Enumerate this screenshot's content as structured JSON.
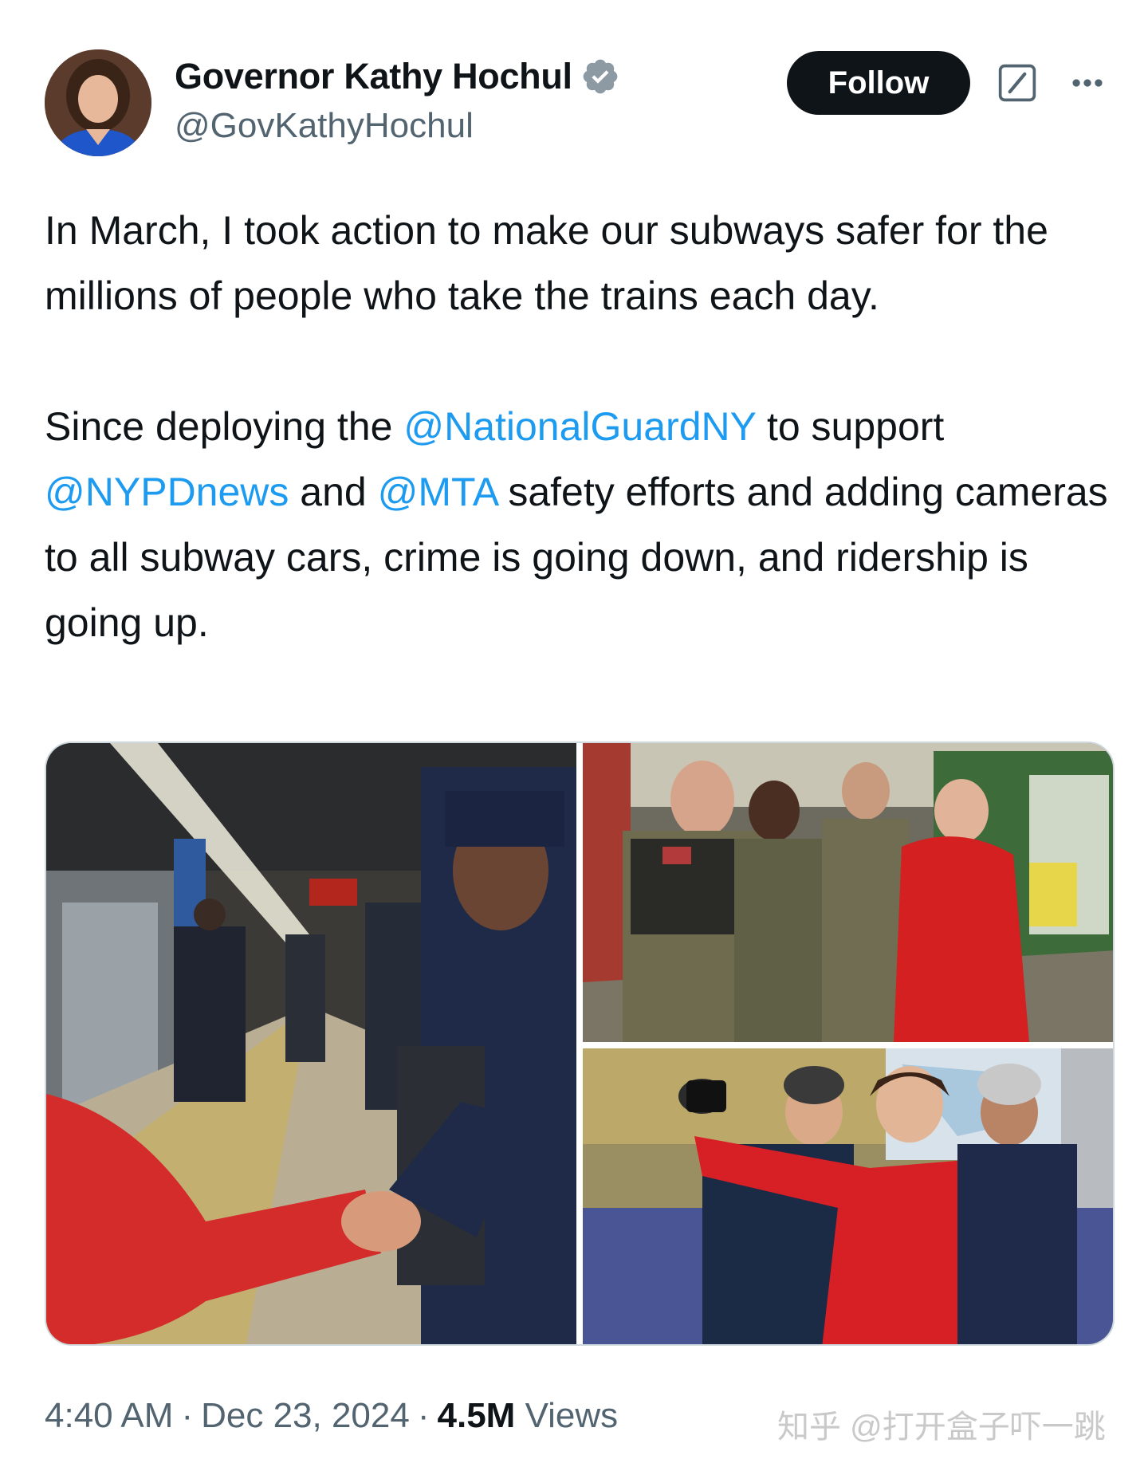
{
  "author": {
    "display_name": "Governor Kathy Hochul",
    "handle": "@GovKathyHochul",
    "verified_icon": "verified-badge-icon"
  },
  "actions": {
    "follow_label": "Follow",
    "grok_icon": "grok-icon",
    "more_icon": "more-options-icon"
  },
  "tweet": {
    "p1": "In March, I took action to make our subways safer for the millions of people who take the trains each day.",
    "p2_a": "Since deploying the ",
    "mention_1": "@NationalGuardNY",
    "p2_b": " to support ",
    "mention_2": "@NYPDnews",
    "p2_c": " and ",
    "mention_3": "@MTA",
    "p2_d": " safety efforts and adding cameras to all subway cars, crime is going down, and ridership is going up."
  },
  "meta": {
    "time": "4:40 AM",
    "date": "Dec 23, 2024",
    "views_count": "4.5M",
    "views_label": "Views"
  },
  "watermark": "知乎 @打开盒子吓一跳",
  "colors": {
    "text": "#0f1419",
    "secondary": "#536471",
    "link": "#1d9bf0",
    "verified": "#1d9bf0",
    "follow_bg": "#0f1419"
  }
}
